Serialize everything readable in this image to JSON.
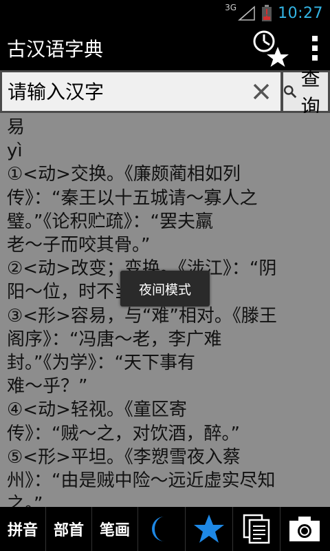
{
  "status": {
    "network": "3G",
    "time": "10:27"
  },
  "app": {
    "title": "古汉语字典"
  },
  "search": {
    "placeholder": "请输入汉字",
    "query_label": "查询"
  },
  "entry": {
    "char": "易",
    "pinyin": "yì",
    "lines": [
      "①<动>交换。《廉颇蔺相如列",
      "传》：“秦王以十五城请～寡人之",
      "璧。”《论积贮疏》：“罢夫羸",
      "老～子而咬其骨。”",
      "②<动>改变；变换。《涉江》：“阴",
      "阳～位，时不当兮。”",
      "③<形>容易，与“难”相对。《滕王",
      "阁序》：“冯唐～老，李广难",
      "封。”《为学》：“天下事有",
      "难～乎？”",
      "④<动>轻视。《童区寄",
      "传》：“贼～之，对饮酒，醉。”",
      "⑤<形>平坦。《李愬雪夜入蔡",
      "州》：“由是贼中险～远近虚实尽知",
      "之。”"
    ]
  },
  "toast": {
    "text": "夜间模式"
  },
  "bottom": {
    "pinyin": "拼音",
    "radical": "部首",
    "strokes": "笔画"
  },
  "colors": {
    "clock": "#33b5e5",
    "battery": "#d32f2f",
    "content_bg": "#8d8d8d",
    "toolbar_blue": "#1e88e5"
  }
}
